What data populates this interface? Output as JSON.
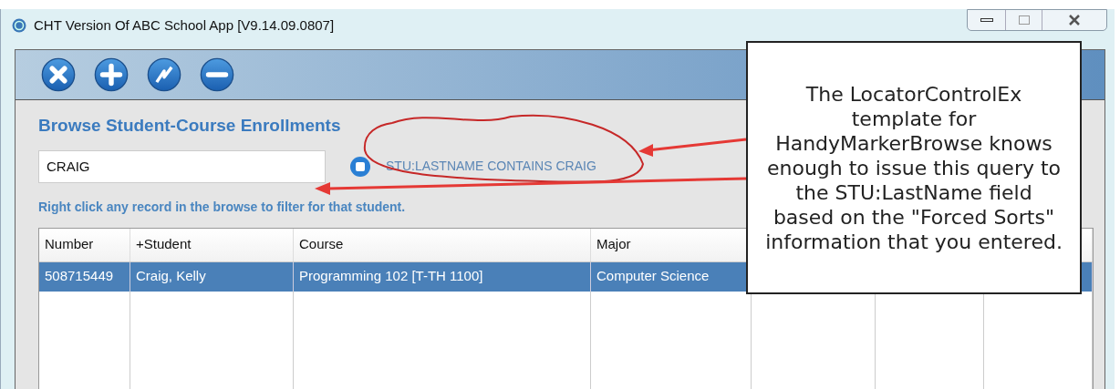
{
  "window": {
    "title": "CHT Version Of ABC School App [V9.14.09.0807]"
  },
  "toolbar": {
    "buttons": [
      {
        "kind": "close"
      },
      {
        "kind": "add"
      },
      {
        "kind": "change"
      },
      {
        "kind": "delete"
      }
    ]
  },
  "heading": "Browse Student-Course Enrollments",
  "search": {
    "value": "CRAIG"
  },
  "query": "STU:LASTNAME CONTAINS CRAIG",
  "hint": "Right click any record in the browse to filter for that student.",
  "table": {
    "columns": [
      "Number",
      "+Student",
      "Course",
      "Major"
    ],
    "rows": [
      {
        "selected": true,
        "cells": [
          "508715449",
          "Craig, Kelly",
          "Programming 102 [T-TH 1100]",
          "Computer Science"
        ]
      }
    ]
  },
  "callout": "The LocatorControlEx template for HandyMarkerBrowse knows enough to issue this query to the STU:LastName field based on the \"Forced Sorts\" information that you entered."
}
